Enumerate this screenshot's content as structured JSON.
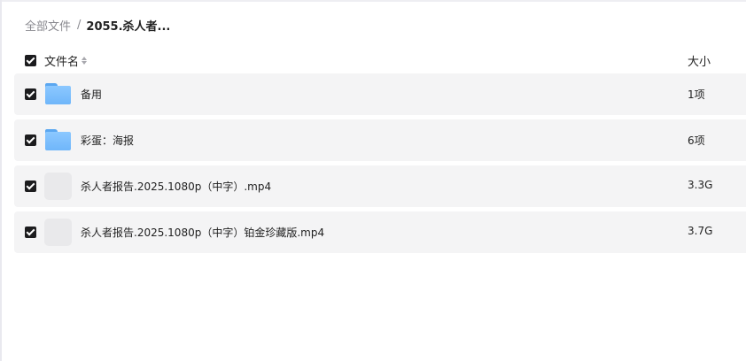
{
  "breadcrumb": {
    "root": "全部文件",
    "separator": "/",
    "current": "2055.杀人者..."
  },
  "header": {
    "name_label": "文件名",
    "size_label": "大小",
    "sort_icon": "sort-icon"
  },
  "files": [
    {
      "name": "备用",
      "size": "1项",
      "icon": "folder-icon",
      "checked": true
    },
    {
      "name": "彩蛋：海报",
      "size": "6项",
      "icon": "folder-icon",
      "checked": true
    },
    {
      "name": "杀人者报告.2025.1080p（中字）.mp4",
      "size": "3.3G",
      "icon": "file-icon",
      "checked": true
    },
    {
      "name": "杀人者报告.2025.1080p（中字）铂金珍藏版.mp4",
      "size": "3.7G",
      "icon": "file-icon",
      "checked": true
    }
  ],
  "colors": {
    "row_bg": "#f4f4f5",
    "checkbox": "#1c1c1e",
    "folder": "#7dbefc",
    "muted_text": "#8a8a90"
  }
}
